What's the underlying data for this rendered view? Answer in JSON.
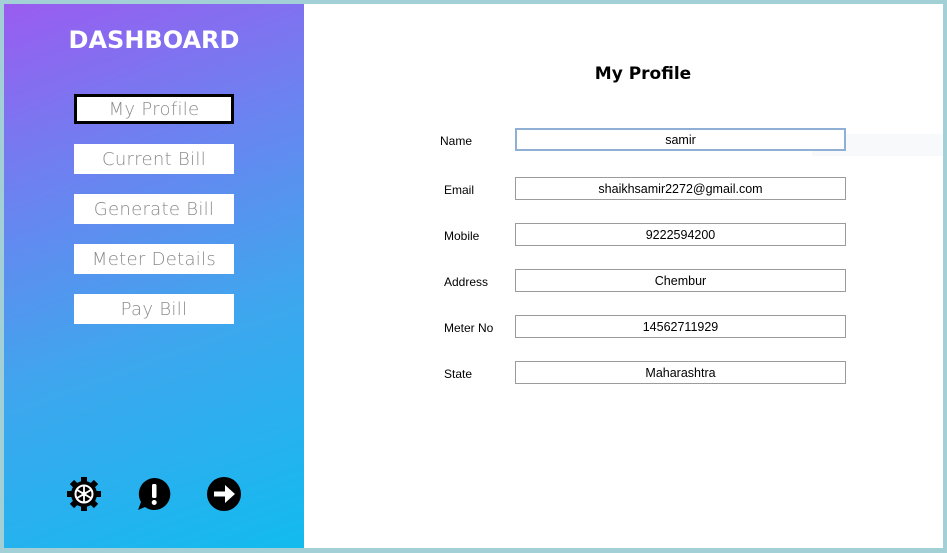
{
  "sidebar": {
    "title": "DASHBOARD",
    "nav": [
      {
        "label": "My Profile"
      },
      {
        "label": "Current Bill"
      },
      {
        "label": "Generate Bill"
      },
      {
        "label": "Meter Details"
      },
      {
        "label": "Pay Bill"
      }
    ],
    "icons": [
      "settings-icon",
      "alert-icon",
      "logout-icon"
    ]
  },
  "profile": {
    "title": "My Profile",
    "fields": [
      {
        "label": "Name",
        "value": "samir"
      },
      {
        "label": "Email",
        "value": "shaikhsamir2272@gmail.com"
      },
      {
        "label": "Mobile",
        "value": "9222594200"
      },
      {
        "label": "Address",
        "value": "Chembur"
      },
      {
        "label": "Meter No",
        "value": "14562711929"
      },
      {
        "label": "State",
        "value": "Maharashtra"
      }
    ]
  },
  "colors": {
    "gradient_top": "#9a5cf0",
    "gradient_bottom": "#12bbee",
    "window_border": "#a3cfd6"
  }
}
